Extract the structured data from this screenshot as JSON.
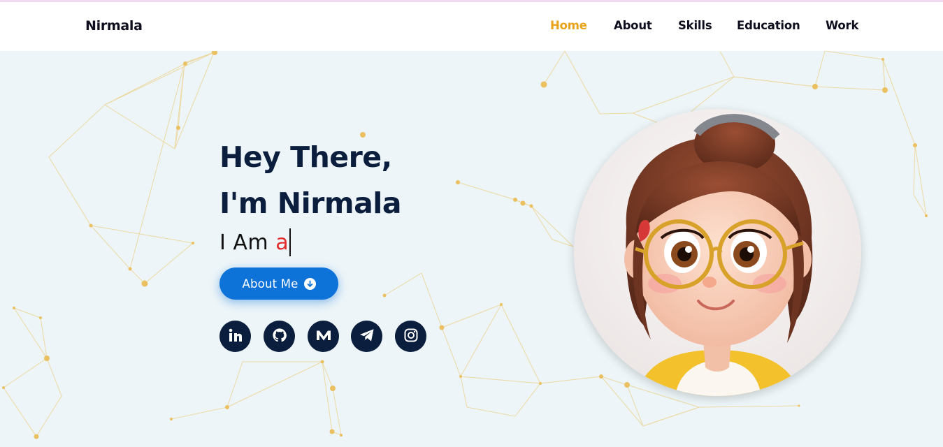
{
  "header": {
    "brand": "Nirmala",
    "nav": [
      {
        "label": "Home",
        "active": true
      },
      {
        "label": "About",
        "active": false
      },
      {
        "label": "Skills",
        "active": false
      },
      {
        "label": "Education",
        "active": false
      },
      {
        "label": "Work",
        "active": false
      }
    ]
  },
  "hero": {
    "greeting_line1": "Hey There,",
    "greeting_line2": "I'm Nirmala",
    "typing_prefix": "I Am",
    "typing_text": "a",
    "button_label": "About Me",
    "socials": [
      {
        "name": "linkedin-icon"
      },
      {
        "name": "github-icon"
      },
      {
        "name": "medium-icon"
      },
      {
        "name": "telegram-icon"
      },
      {
        "name": "instagram-icon"
      }
    ]
  },
  "colors": {
    "accent": "#e9a318",
    "heading": "#0b1e3d",
    "button": "#0e73d9",
    "typed": "#e22c2c",
    "background": "#edf5f8"
  }
}
